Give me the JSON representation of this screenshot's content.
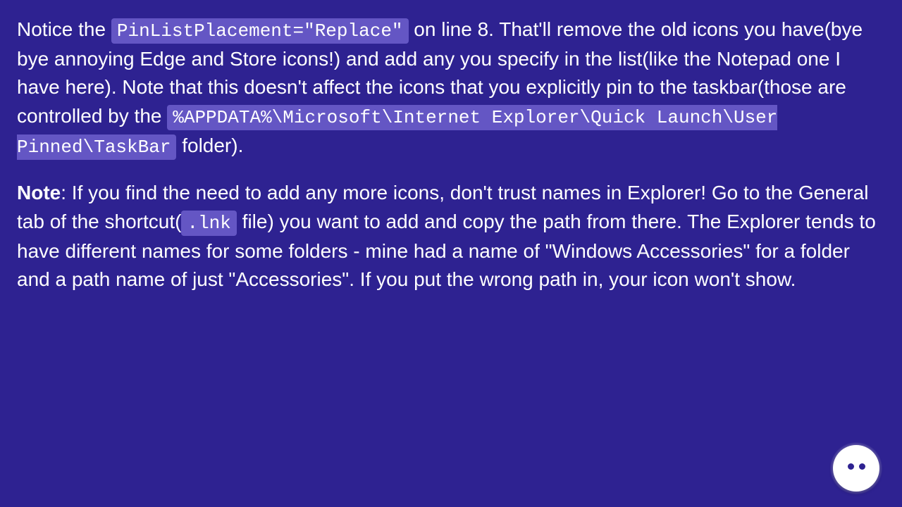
{
  "para1": {
    "t1": "Notice the ",
    "code1": "PinListPlacement=\"Replace\"",
    "t2": " on line 8. That'll remove the old icons you have(bye bye annoying Edge and Store icons!) and add any you specify in the list(like the Notepad one I have here). Note that this doesn't affect the icons that you explicitly pin to the taskbar(those are controlled by the ",
    "code2": "%APPDATA%\\Microsoft\\Internet Explorer\\Quick Launch\\User Pinned\\TaskBar",
    "t3": " folder)."
  },
  "para2": {
    "bold": "Note",
    "t1": ": If you find the need to add any more icons, don't trust names in Explorer! Go to the General tab of the shortcut(",
    "code1": ".lnk",
    "t2": " file) you want to add and copy the path from there. The Explorer tends to have different names for some folders - mine had a name of \"Windows Accessories\" for a folder and a path name of just \"Accessories\". If you put the wrong path in, your icon won't show."
  }
}
